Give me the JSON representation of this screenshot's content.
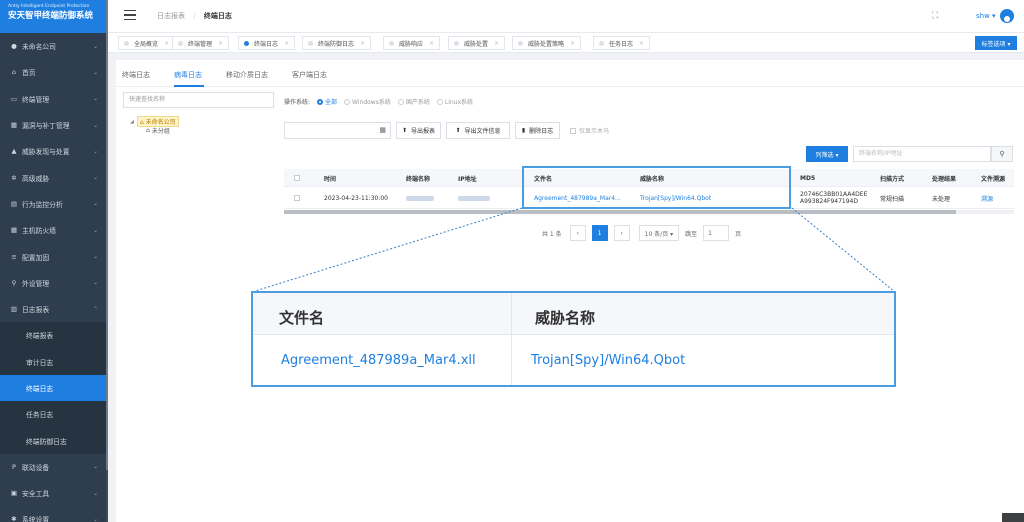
{
  "brand": {
    "subtitle": "Antiy Intelligent Endpoint Protection",
    "title": "安天智甲终端防御系统"
  },
  "sidebar": {
    "items": [
      {
        "label": "未命名公司",
        "icon": "pin-icon",
        "glyph": "●",
        "chevron": "⌄"
      },
      {
        "label": "首页",
        "icon": "home-icon",
        "glyph": "⌂",
        "chevron": "⌄"
      },
      {
        "label": "终端管理",
        "icon": "monitor-icon",
        "glyph": "▭",
        "chevron": "⌄"
      },
      {
        "label": "漏洞与补丁管理",
        "icon": "patch-icon",
        "glyph": "▦",
        "chevron": "⌄"
      },
      {
        "label": "威胁发现与处置",
        "icon": "alert-icon",
        "glyph": "▲",
        "chevron": "⌄"
      },
      {
        "label": "高级威胁",
        "icon": "bug-icon",
        "glyph": "✲",
        "chevron": "⌄"
      },
      {
        "label": "行为监控分析",
        "icon": "chart-icon",
        "glyph": "▤",
        "chevron": "⌄"
      },
      {
        "label": "主机防火墙",
        "icon": "firewall-icon",
        "glyph": "▦",
        "chevron": "⌄"
      },
      {
        "label": "配置加固",
        "icon": "config-icon",
        "glyph": "≡",
        "chevron": "⌄"
      },
      {
        "label": "外设管理",
        "icon": "usb-icon",
        "glyph": "⚲",
        "chevron": "⌄"
      },
      {
        "label": "日志报表",
        "icon": "log-icon",
        "glyph": "▥",
        "chevron": "⌃"
      }
    ],
    "subitems": [
      {
        "label": "终端报表"
      },
      {
        "label": "审计日志"
      },
      {
        "label": "终端日志"
      },
      {
        "label": "任务日志"
      },
      {
        "label": "终端防御日志"
      }
    ],
    "bottom": [
      {
        "label": "联动设备",
        "icon": "link-icon",
        "glyph": "P",
        "chevron": "⌄"
      },
      {
        "label": "安全工具",
        "icon": "toolbox-icon",
        "glyph": "▣",
        "chevron": "⌄"
      },
      {
        "label": "系统设置",
        "icon": "gear-icon",
        "glyph": "✱",
        "chevron": "⌄"
      }
    ]
  },
  "header": {
    "breadcrumb_parent": "日志报表",
    "breadcrumb_sep": "/",
    "breadcrumb_current": "终端日志",
    "fullscreen_glyph": "⛶",
    "user": "shw ▾"
  },
  "page_tabs": [
    {
      "label": "全局概览"
    },
    {
      "label": "终端管理"
    },
    {
      "label": "终端日志"
    },
    {
      "label": "终端防御日志"
    },
    {
      "label": "威胁响应"
    },
    {
      "label": "威胁处置"
    },
    {
      "label": "威胁处置策略"
    },
    {
      "label": "任务日志"
    }
  ],
  "tab_close": "×",
  "tab_options": "标签选项 ▾",
  "sub_tabs": [
    "终端日志",
    "病毒日志",
    "移动介质日志",
    "客户端日志"
  ],
  "quick_search_placeholder": "快速查找名称",
  "tree": {
    "root": "未命名公司",
    "child": "未分组",
    "arrow": "◢",
    "root_icon": "⌂",
    "child_icon": "⌂"
  },
  "os_filter": {
    "label": "操作系统:",
    "options": [
      "全部",
      "Windows系统",
      "国产系统",
      "Linux系统"
    ]
  },
  "toolbar": {
    "cal": "▦",
    "export_report": "导出报表",
    "export_file": "导出文件信息",
    "delete_log": "删除日志",
    "export_icon": "⬆",
    "delete_icon": "▮",
    "encrypt_only": "仅显示木马"
  },
  "filter_btn": "列筛选 ▾",
  "search_placeholder": "终端名称/IP地址",
  "search_glyph": "⚲",
  "table": {
    "headers": [
      "时间",
      "终端名称",
      "IP地址",
      "文件名",
      "威胁名称",
      "MD5",
      "扫描方式",
      "处理结果",
      "文件溯源"
    ],
    "row": {
      "time": "2023-04-23-11:30:00",
      "file": "Agreement_487989a_Mar4...",
      "threat": "Trojan[Spy]/Win64.Qbot",
      "md5_1": "20746C3BB01AA4DEE",
      "md5_2": "A993824F947194D",
      "scan": "常规扫描",
      "result": "未处理",
      "trace": "溯源"
    }
  },
  "pager": {
    "total": "共 1 条",
    "prev": "‹",
    "page": "1",
    "next": "›",
    "size": "10 条/页 ▾",
    "goto": "跳至",
    "goto_value": "1",
    "page_suffix": "页"
  },
  "callout": {
    "col1": "文件名",
    "col2": "威胁名称",
    "file": "Agreement_487989a_Mar4.xll",
    "threat": "Trojan[Spy]/Win64.Qbot"
  },
  "colors": {
    "accent": "#1f7fe0",
    "sidebar": "#2f3e4f",
    "highlight": "#4a9de0"
  }
}
